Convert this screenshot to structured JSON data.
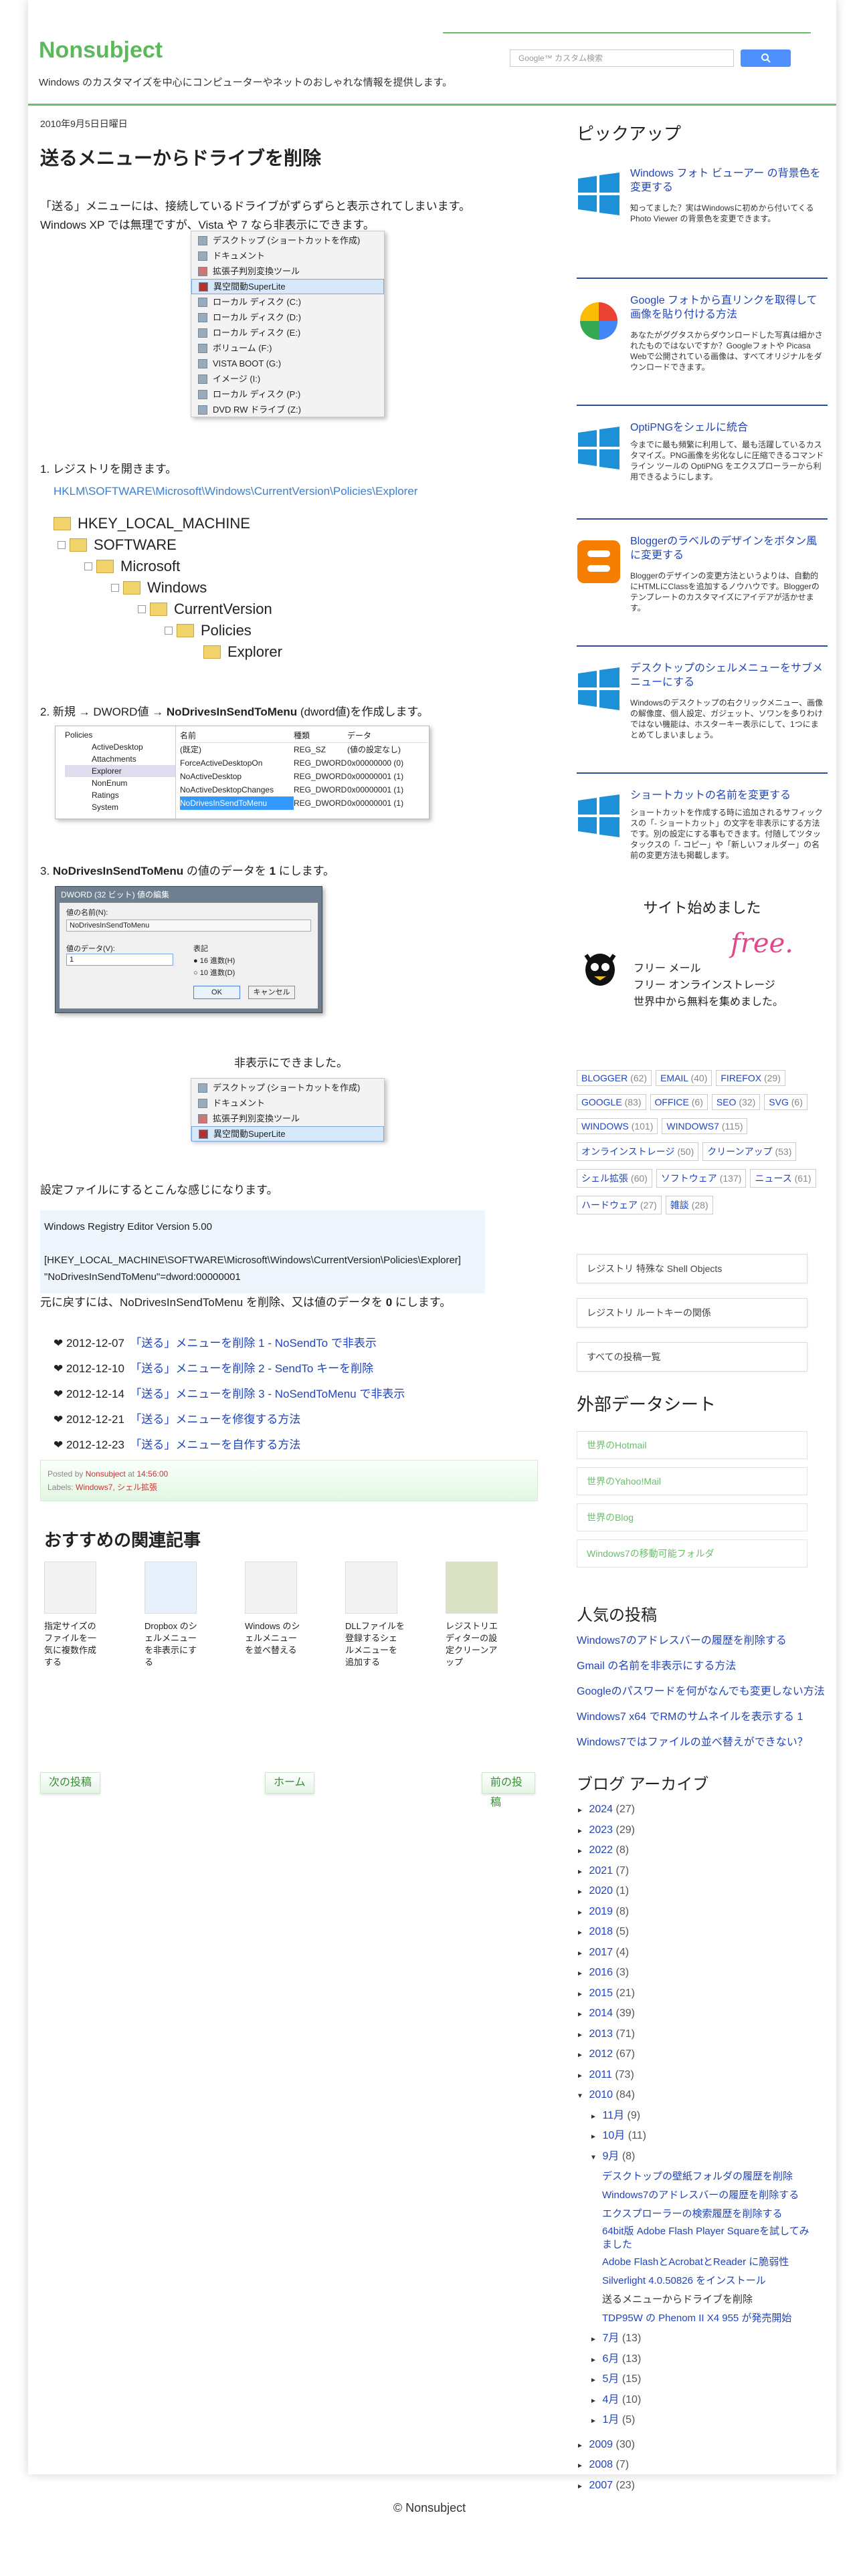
{
  "header": {
    "title": "Nonsubject",
    "description": "Windows のカスタマイズを中心にコンピューターやネットのおしゃれな情報を提供します。",
    "search_placeholder": "Google™ カスタム検索"
  },
  "post": {
    "date": "2010年9月5日日曜日",
    "title": "送るメニューからドライブを削除",
    "intro1": "「送る」メニューには、接続しているドライブがずらずらと表示されてしまいます。",
    "intro2": "Windows XP では無理ですが、Vista や 7 なら非表示にできます。",
    "menu_items": [
      "デスクトップ (ショートカットを作成)",
      "ドキュメント",
      "拡張子判別変換ツール",
      "異空間動SuperLite",
      "ローカル ディスク (C:)",
      "ローカル ディスク (D:)",
      "ローカル ディスク (E:)",
      "ボリューム (F:)",
      "VISTA BOOT (G:)",
      "イメージ (I:)",
      "ローカル ディスク (P:)",
      "DVD RW ドライブ (Z:)"
    ],
    "step1": "1. レジストリを開きます。",
    "reg_path": "HKLM\\SOFTWARE\\Microsoft\\Windows\\CurrentVersion\\Policies\\Explorer",
    "tree": [
      "HKEY_LOCAL_MACHINE",
      "SOFTWARE",
      "Microsoft",
      "Windows",
      "CurrentVersion",
      "Policies",
      "Explorer"
    ],
    "step2_a": "2. 新規 → DWORD値 → ",
    "step2_b": "NoDrivesInSendToMenu",
    "step2_c": " (dword値)を作成します。",
    "regedit": {
      "left": [
        "Policies",
        "ActiveDesktop",
        "Attachments",
        "Explorer",
        "NonEnum",
        "Ratings",
        "System"
      ],
      "headers": [
        "名前",
        "種類",
        "データ"
      ],
      "rows": [
        [
          "(既定)",
          "REG_SZ",
          "(値の設定なし)"
        ],
        [
          "ForceActiveDesktopOn",
          "REG_DWORD",
          "0x00000000 (0)"
        ],
        [
          "NoActiveDesktop",
          "REG_DWORD",
          "0x00000001 (1)"
        ],
        [
          "NoActiveDesktopChanges",
          "REG_DWORD",
          "0x00000001 (1)"
        ],
        [
          "NoDrivesInSendToMenu",
          "REG_DWORD",
          "0x00000001 (1)"
        ]
      ]
    },
    "step3_a": "3. ",
    "step3_b": "NoDrivesInSendToMenu",
    "step3_c": " の値のデータを ",
    "step3_d": "1",
    "step3_e": " にします。",
    "dialog": {
      "title": "DWORD (32 ビット) 値の編集",
      "name_label": "値の名前(N):",
      "name_value": "NoDrivesInSendToMenu",
      "data_label": "値のデータ(V):",
      "data_value": "1",
      "base_label": "表記",
      "hex": "16 進数(H)",
      "dec": "10 進数(D)",
      "ok": "OK",
      "cancel": "キャンセル"
    },
    "hidden_text": "非表示にできました。",
    "menu_items2": [
      "デスクトップ (ショートカットを作成)",
      "ドキュメント",
      "拡張子判別変換ツール",
      "異空間動SuperLite"
    ],
    "config_text": "設定ファイルにするとこんな感じになります。",
    "code": [
      "Windows Registry Editor Version 5.00",
      "",
      "[HKEY_LOCAL_MACHINE\\SOFTWARE\\Microsoft\\Windows\\CurrentVersion\\Policies\\Explorer]",
      "\"NoDrivesInSendToMenu\"=dword:00000001"
    ],
    "restore_a": "元に戻すには、NoDrivesInSendToMenu を削除、又は値のデータを ",
    "restore_b": "0",
    "restore_c": " にします。",
    "series": [
      {
        "date": "2012-12-07",
        "title": "「送る」メニューを削除 1 - NoSendTo で非表示"
      },
      {
        "date": "2012-12-10",
        "title": "「送る」メニューを削除 2 - SendTo キーを削除"
      },
      {
        "date": "2012-12-14",
        "title": "「送る」メニューを削除 3 - NoSendToMenu で非表示"
      },
      {
        "date": "2012-12-21",
        "title": "「送る」メニューを修復する方法"
      },
      {
        "date": "2012-12-23",
        "title": "「送る」メニューを自作する方法"
      }
    ],
    "posted_by": "Posted by",
    "author": "Nonsubject",
    "at": "at",
    "time": "14:56:00",
    "labels_label": "Labels:",
    "labels": "Windows7, シェル拡張"
  },
  "related": {
    "title": "おすすめの関連記事",
    "items": [
      "指定サイズのファイルを一気に複数作成する",
      "Dropbox のシェルメニューを非表示にする",
      "Windows のシェルメニューを並べ替える",
      "DLLファイルを登録するシェルメニューを追加する",
      "レジストリエディターの設定クリーンアップ"
    ]
  },
  "nav": {
    "newer": "次の投稿",
    "home": "ホーム",
    "older": "前の投稿"
  },
  "sidebar": {
    "pickup_title": "ピックアップ",
    "pickups": [
      {
        "title": "Windows フォト ビューアー の背景色を変更する",
        "desc": "知ってました？実はWindowsに初めから付いてくる Photo Viewer の背景色を変更できます。"
      },
      {
        "title": "Google フォトから直リンクを取得して画像を貼り付ける方法",
        "desc": "あなたがググタスからダウンロードした写真は細かされたものではないですか？Googleフォトや Picasa Webで公開されている画像は、すべてオリジナルをダウンロードできます。"
      },
      {
        "title": "OptiPNGをシェルに統合",
        "desc": "今までに最も頻繁に利用して、最も活躍しているカスタマイズ。PNG画像を劣化なしに圧縮できるコマンドライン ツールの OptiPNG をエクスプローラーから利用できるようにします。"
      },
      {
        "title": "Bloggerのラベルのデザインをボタン風に変更する",
        "desc": "Bloggerのデザインの変更方法というよりは、自動的にHTMLにClassを追加するノウハウです。Bloggerのテンプレートのカスタマイズにアイデアが活かせます。"
      },
      {
        "title": "デスクトップのシェルメニューをサブメニューにする",
        "desc": "Windowsのデスクトップの右クリックメニュー、画像の解像度、個人設定、ガジェット、ソワンを多りわけではない機能は、ホスターキー表示にして、1つにまとめてしまいましょう。"
      },
      {
        "title": "ショートカットの名前を変更する",
        "desc": "ショートカットを作成する時に追加されるサフィックスの「- ショートカット」の文字を非表示にする方法です。別の設定にする事もできます。付随してツタッタックスの「- コピー」や「新しいフォルダー」の名前の変更方法も掲載します。"
      }
    ],
    "promo_title": "サイト始めました",
    "promo_lines": [
      "フリー メール",
      "フリー オンラインストレージ",
      "世界中から無料を集めました。"
    ],
    "promo_free": "free.",
    "tags": [
      [
        "BLOGGER",
        "62"
      ],
      [
        "EMAIL",
        "40"
      ],
      [
        "FIREFOX",
        "29"
      ],
      [
        "GOOGLE",
        "83"
      ],
      [
        "OFFICE",
        "6"
      ],
      [
        "SEO",
        "32"
      ],
      [
        "SVG",
        "6"
      ],
      [
        "WINDOWS",
        "101"
      ],
      [
        "WINDOWS7",
        "115"
      ],
      [
        "オンラインストレージ",
        "50"
      ],
      [
        "クリーンアップ",
        "53"
      ],
      [
        "シェル拡張",
        "60"
      ],
      [
        "ソフトウェア",
        "137"
      ],
      [
        "ニュース",
        "61"
      ],
      [
        "ハードウェア",
        "27"
      ],
      [
        "雑談",
        "28"
      ]
    ],
    "boxes": [
      "レジストリ 特殊な Shell Objects",
      "レジストリ ルートキーの関係",
      "すべての投稿一覧"
    ],
    "external_title": "外部データシート",
    "external": [
      "世界のHotmail",
      "世界のYahoo!Mail",
      "世界のBlog",
      "Windows7の移動可能フォルダ"
    ],
    "popular_title": "人気の投稿",
    "popular": [
      "Windows7のアドレスバーの履歴を削除する",
      "Gmail の名前を非表示にする方法",
      "Googleのパスワードを何がなんでも変更しない方法",
      "Windows7 x64 でRMのサムネイルを表示する 1",
      "Windows7ではファイルの並べ替えができない？"
    ],
    "archive_title": "ブログ アーカイブ",
    "archive": [
      [
        "2024",
        "27"
      ],
      [
        "2023",
        "29"
      ],
      [
        "2022",
        "8"
      ],
      [
        "2021",
        "7"
      ],
      [
        "2020",
        "1"
      ],
      [
        "2019",
        "8"
      ],
      [
        "2018",
        "5"
      ],
      [
        "2017",
        "4"
      ],
      [
        "2016",
        "3"
      ],
      [
        "2015",
        "21"
      ],
      [
        "2014",
        "39"
      ],
      [
        "2013",
        "71"
      ],
      [
        "2012",
        "67"
      ],
      [
        "2011",
        "73"
      ]
    ],
    "archive_open": [
      "2010",
      "84"
    ],
    "months_before": [
      [
        "11月",
        "9"
      ],
      [
        "10月",
        "11"
      ]
    ],
    "sep": [
      "9月",
      "8"
    ],
    "sep_posts": [
      "デスクトップの壁紙フォルダの履歴を削除",
      "Windows7のアドレスバーの履歴を削除する",
      "エクスプローラーの検索履歴を削除する",
      "64bit版 Adobe Flash Player Squareを試してみました",
      "Adobe FlashとAcrobatとReader に脆弱性",
      "Silverlight 4.0.50826 をインストール",
      "送るメニューからドライブを削除",
      "TDP95W の Phenom II X4 955 が発売開始"
    ],
    "months_after": [
      [
        "7月",
        "13"
      ],
      [
        "6月",
        "13"
      ],
      [
        "5月",
        "15"
      ],
      [
        "4月",
        "10"
      ],
      [
        "1月",
        "5"
      ]
    ],
    "archive_after": [
      [
        "2009",
        "30"
      ],
      [
        "2008",
        "7"
      ],
      [
        "2007",
        "23"
      ]
    ]
  },
  "copyright": "© Nonsubject",
  "colors": {
    "accent": "#5bb85b",
    "link": "#2244bb",
    "rule": "#2a4a9a"
  }
}
